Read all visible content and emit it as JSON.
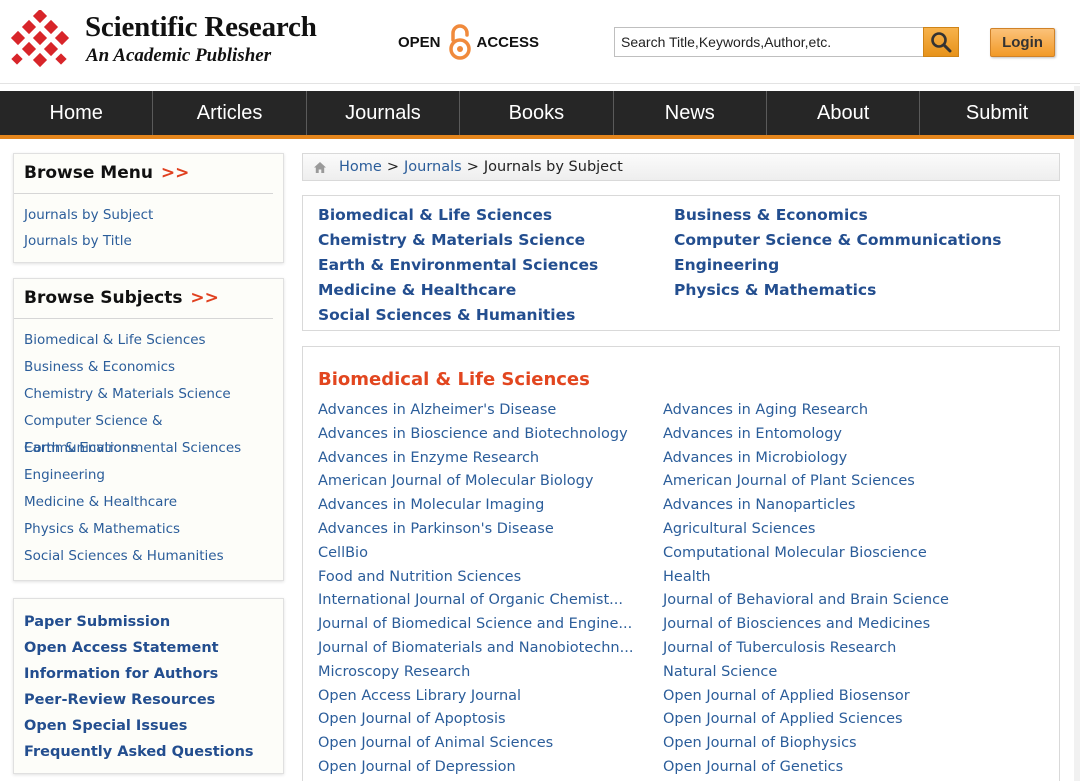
{
  "header": {
    "logo_title": "Scientific Research",
    "logo_subtitle": "An Academic Publisher",
    "open_access_left": "OPEN",
    "open_access_right": "ACCESS",
    "search_placeholder": "Search Title,Keywords,Author,etc.",
    "login_label": "Login",
    "icons": {
      "logo": "scirp-logo-icon",
      "open_access": "open-lock-icon",
      "search": "search-icon"
    }
  },
  "nav": [
    "Home",
    "Articles",
    "Journals",
    "Books",
    "News",
    "About",
    "Submit"
  ],
  "sidebar": {
    "browse_menu": {
      "title": "Browse Menu",
      "arrows": ">>",
      "items": [
        "Journals by Subject",
        "Journals by Title"
      ]
    },
    "browse_subjects": {
      "title": "Browse Subjects",
      "arrows": ">>",
      "items": [
        "Biomedical & Life Sciences",
        "Business & Economics",
        "Chemistry & Materials Science",
        "Computer Science & Communications",
        "Earth & Environmental Sciences",
        "Engineering",
        "Medicine & Healthcare",
        "Physics & Mathematics",
        "Social Sciences & Humanities"
      ]
    },
    "links": [
      "Paper Submission",
      "Open Access Statement",
      "Information for Authors",
      "Peer-Review Resources",
      "Open Special Issues",
      "Frequently Asked Questions"
    ]
  },
  "breadcrumb": {
    "home": "Home",
    "journals": "Journals",
    "current": "Journals by Subject",
    "separator": ">"
  },
  "subjects": {
    "left": [
      "Biomedical & Life Sciences",
      "Chemistry & Materials Science",
      "Earth & Environmental Sciences",
      "Medicine & Healthcare",
      "Social Sciences & Humanities"
    ],
    "right": [
      "Business & Economics",
      "Computer Science & Communications",
      "Engineering",
      "Physics & Mathematics"
    ]
  },
  "journals": {
    "heading": "Biomedical & Life Sciences",
    "left": [
      "Advances in Alzheimer's Disease",
      "Advances in Bioscience and Biotechnology",
      "Advances in Enzyme Research",
      "American Journal of Molecular Biology",
      "Advances in Molecular Imaging",
      "Advances in Parkinson's Disease",
      "CellBio",
      "Food and Nutrition Sciences",
      "International Journal of Organic Chemist...",
      "Journal of Biomedical Science and Engine...",
      "Journal of Biomaterials and Nanobiotechn...",
      "Microscopy Research",
      "Open Access Library Journal",
      "Open Journal of Apoptosis",
      "Open Journal of Animal Sciences",
      "Open Journal of Depression"
    ],
    "right": [
      "Advances in Aging Research",
      "Advances in Entomology",
      "Advances in Microbiology",
      "American Journal of Plant Sciences",
      "Advances in Nanoparticles",
      "Agricultural Sciences",
      "Computational Molecular Bioscience",
      "Health",
      "Journal of Behavioral and Brain Science",
      "Journal of Biosciences and Medicines",
      "Journal of Tuberculosis Research",
      "Natural Science",
      "Open Journal of Applied Biosensor",
      "Open Journal of Applied Sciences",
      "Open Journal of Biophysics",
      "Open Journal of Genetics"
    ]
  },
  "colors": {
    "nav_bg": "#262626",
    "nav_accent": "#e4851c",
    "link": "#2b5d9a",
    "heading_red": "#e2461f",
    "logo_red": "#d8252a"
  }
}
